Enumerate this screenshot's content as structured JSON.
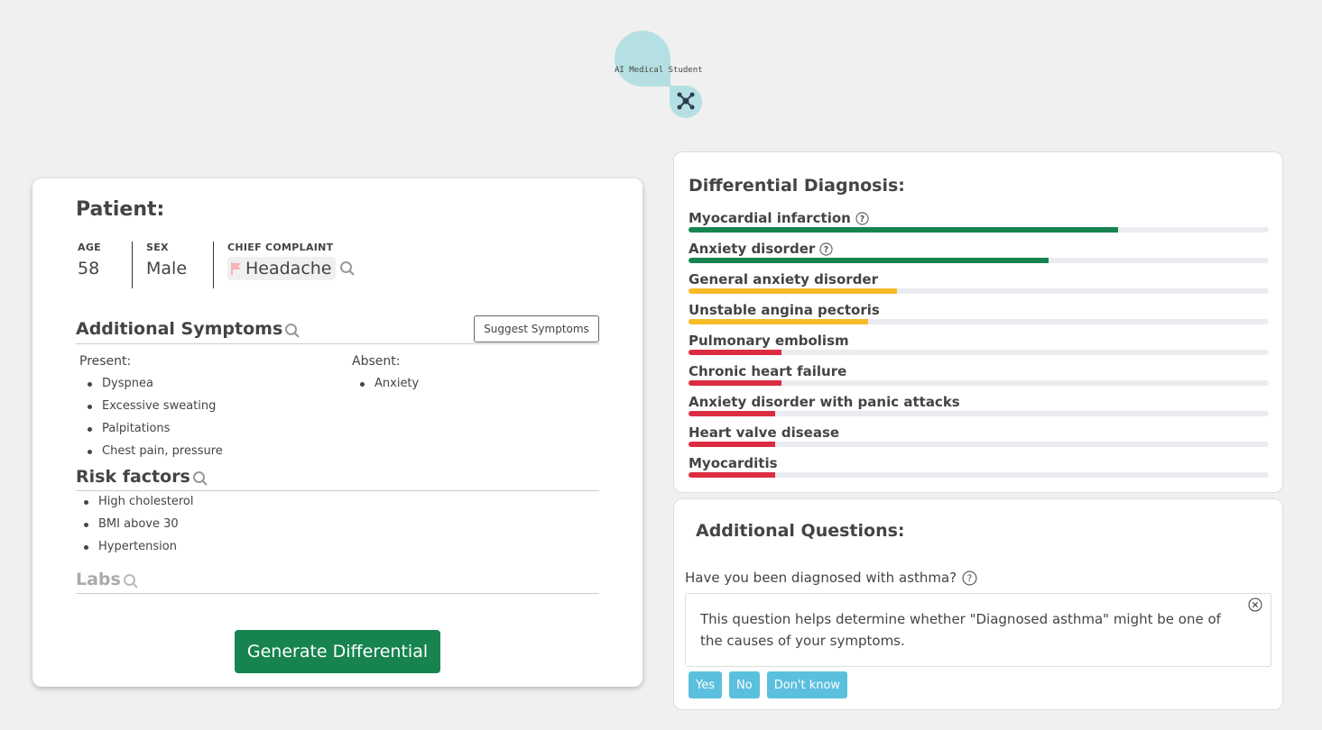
{
  "logo": {
    "text": "AI Medical Student"
  },
  "patient": {
    "title": "Patient:",
    "age_label": "AGE",
    "age": "58",
    "sex_label": "SEX",
    "sex": "Male",
    "cc_label": "CHIEF COMPLAINT",
    "cc": "Headache"
  },
  "symptoms": {
    "title": "Additional Symptoms",
    "suggest_label": "Suggest Symptoms",
    "present_label": "Present:",
    "absent_label": "Absent:",
    "present": [
      "Dyspnea",
      "Excessive sweating",
      "Palpitations",
      "Chest pain, pressure"
    ],
    "absent": [
      "Anxiety"
    ]
  },
  "risk": {
    "title": "Risk factors",
    "items": [
      "High cholesterol",
      "BMI above 30",
      "Hypertension"
    ]
  },
  "labs": {
    "title": "Labs"
  },
  "generate_label": "Generate Differential",
  "differential": {
    "title": "Differential Diagnosis:",
    "items": [
      {
        "name": "Myocardial infarction",
        "help": true,
        "value": 0.74,
        "color": "#17844f"
      },
      {
        "name": "Anxiety disorder",
        "help": true,
        "value": 0.62,
        "color": "#17844f"
      },
      {
        "name": "General anxiety disorder",
        "help": false,
        "value": 0.36,
        "color": "#f7bb2a"
      },
      {
        "name": "Unstable angina pectoris",
        "help": false,
        "value": 0.31,
        "color": "#f7bb2a"
      },
      {
        "name": "Pulmonary embolism",
        "help": false,
        "value": 0.16,
        "color": "#dc2c41"
      },
      {
        "name": "Chronic heart failure",
        "help": false,
        "value": 0.16,
        "color": "#dc2c41"
      },
      {
        "name": "Anxiety disorder with panic attacks",
        "help": false,
        "value": 0.15,
        "color": "#dc2c41"
      },
      {
        "name": "Heart valve disease",
        "help": false,
        "value": 0.15,
        "color": "#dc2c41"
      },
      {
        "name": "Myocarditis",
        "help": false,
        "value": 0.15,
        "color": "#dc2c41"
      }
    ]
  },
  "questions": {
    "title": "Additional Questions:",
    "question": "Have you been diagnosed with asthma?",
    "explanation": "This question helps determine whether \"Diagnosed asthma\" might be one of the causes of your symptoms.",
    "answers": [
      "Yes",
      "No",
      "Don't know"
    ]
  }
}
